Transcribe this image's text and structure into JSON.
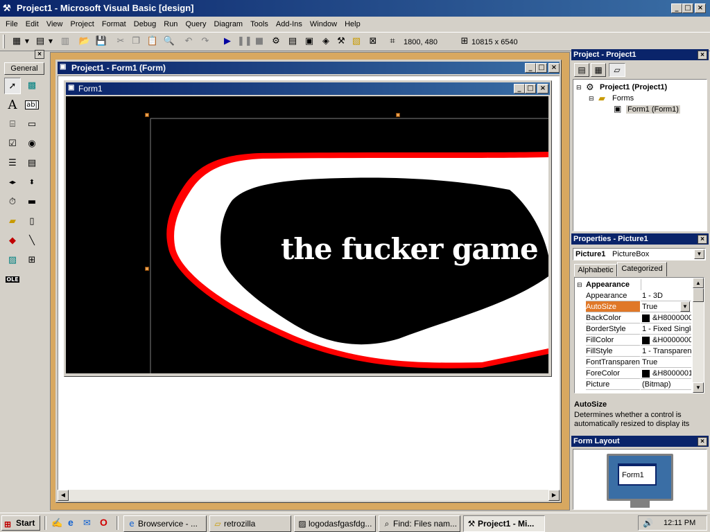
{
  "app": {
    "title": "Project1 - Microsoft Visual Basic [design]",
    "window_buttons": [
      "_",
      "□",
      "×"
    ]
  },
  "menu": [
    "File",
    "Edit",
    "View",
    "Project",
    "Format",
    "Debug",
    "Run",
    "Query",
    "Diagram",
    "Tools",
    "Add-Ins",
    "Window",
    "Help"
  ],
  "toolbar": {
    "position": "1800, 480",
    "size": "10815 x 6540"
  },
  "toolbox": {
    "tab_label": "General"
  },
  "form_designer": {
    "title": "Project1 - Form1 (Form)",
    "form_title": "Form1",
    "picture_text": "the fucker game"
  },
  "project_panel": {
    "title": "Project - Project1",
    "tree": {
      "root": "Project1 (Project1)",
      "folder": "Forms",
      "item": "Form1 (Form1)"
    }
  },
  "properties_panel": {
    "title": "Properties - Picture1",
    "object_name": "Picture1",
    "object_type": "PictureBox",
    "tabs": [
      "Alphabetic",
      "Categorized"
    ],
    "active_tab": "Categorized",
    "category": "Appearance",
    "rows": [
      {
        "name": "Appearance",
        "value": "1 - 3D"
      },
      {
        "name": "AutoSize",
        "value": "True"
      },
      {
        "name": "BackColor",
        "value": "&H8000000"
      },
      {
        "name": "BorderStyle",
        "value": "1 - Fixed Single"
      },
      {
        "name": "FillColor",
        "value": "&H0000000"
      },
      {
        "name": "FillStyle",
        "value": "1 - Transparent"
      },
      {
        "name": "FontTransparent",
        "value": "True"
      },
      {
        "name": "ForeColor",
        "value": "&H8000001"
      },
      {
        "name": "Picture",
        "value": "(Bitmap)"
      }
    ],
    "description_title": "AutoSize",
    "description_text": "Determines whether a control is automatically resized to display its"
  },
  "form_layout": {
    "title": "Form Layout",
    "preview_label": "Form1"
  },
  "taskbar": {
    "start": "Start",
    "buttons": [
      "Browservice - ...",
      "retrozilla",
      "logodasfgasfdg...",
      "Find: Files nam...",
      "Project1 - Mi..."
    ],
    "clock": "12:11 PM"
  }
}
